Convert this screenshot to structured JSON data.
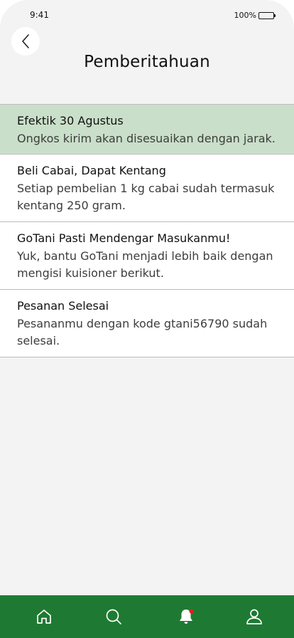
{
  "status_bar": {
    "time": "9:41",
    "battery_percent": "100%"
  },
  "header": {
    "title": "Pemberitahuan"
  },
  "notifications": [
    {
      "title": "Efektik 30 Agustus",
      "body": "Ongkos kirim akan disesuaikan dengan jarak."
    },
    {
      "title": "Beli Cabai, Dapat Kentang",
      "body": "Setiap pembelian 1 kg cabai sudah termasuk kentang 250 gram."
    },
    {
      "title": "GoTani Pasti Mendengar Masukanmu!",
      "body": "Yuk, bantu GoTani menjadi lebih baik dengan mengisi kuisioner berikut."
    },
    {
      "title": "Pesanan Selesai",
      "body": "Pesananmu dengan kode gtani56790 sudah selesai."
    }
  ],
  "bottom_nav": {
    "items": [
      "home-icon",
      "search-icon",
      "bell-icon",
      "user-icon"
    ],
    "active": "bell-icon",
    "badge_color": "#e02020"
  },
  "colors": {
    "nav_background": "#1e7a32",
    "highlight_background": "#c9dfc9",
    "page_background": "#f3f3f3"
  }
}
